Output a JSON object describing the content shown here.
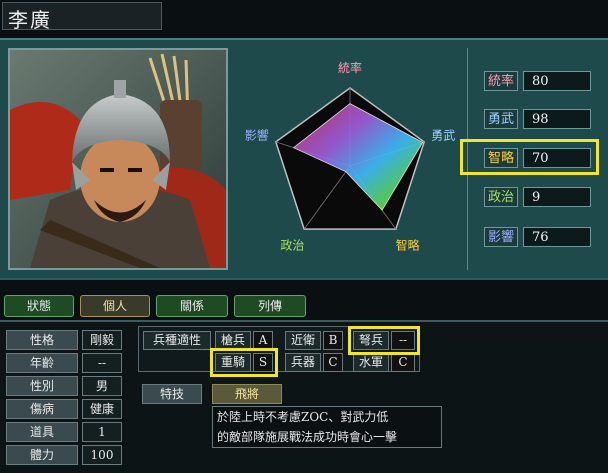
{
  "general": {
    "name": "李廣"
  },
  "radar": {
    "axes": [
      "統率",
      "勇武",
      "智略",
      "政治",
      "影響"
    ],
    "values": [
      80,
      98,
      70,
      9,
      76
    ],
    "max": 100,
    "axis_colors": [
      "#ff9ab0",
      "#9fd0ff",
      "#ffd040",
      "#a8e060",
      "#9ab0ff"
    ]
  },
  "stats": [
    {
      "label": "統率",
      "value": "80",
      "color": "#ff9ab0",
      "highlight": false
    },
    {
      "label": "勇武",
      "value": "98",
      "color": "#9fd0ff",
      "highlight": false
    },
    {
      "label": "智略",
      "value": "70",
      "color": "#ffd040",
      "highlight": true
    },
    {
      "label": "政治",
      "value": "9",
      "color": "#a8e060",
      "highlight": false
    },
    {
      "label": "影響",
      "value": "76",
      "color": "#9ab0ff",
      "highlight": false
    }
  ],
  "tabs": [
    {
      "label": "狀態",
      "active": false
    },
    {
      "label": "個人",
      "active": true
    },
    {
      "label": "關係",
      "active": false
    },
    {
      "label": "列傳",
      "active": false
    }
  ],
  "personal": [
    {
      "label": "性格",
      "value": "剛毅"
    },
    {
      "label": "年齡",
      "value": "--"
    },
    {
      "label": "性別",
      "value": "男"
    },
    {
      "label": "傷病",
      "value": "健康"
    },
    {
      "label": "道具",
      "value": "1"
    },
    {
      "label": "體力",
      "value": "100"
    }
  ],
  "suitability": {
    "header": "兵種適性",
    "units": [
      {
        "name": "槍兵",
        "grade": "A",
        "highlight": false
      },
      {
        "name": "近衛",
        "grade": "B",
        "highlight": false
      },
      {
        "name": "弩兵",
        "grade": "--",
        "highlight": true
      },
      {
        "name": "重騎",
        "grade": "S",
        "highlight": true
      },
      {
        "name": "兵器",
        "grade": "C",
        "highlight": false
      },
      {
        "name": "水軍",
        "grade": "C",
        "highlight": false
      }
    ]
  },
  "skill": {
    "label": "特技",
    "name": "飛將",
    "description_line1": "於陸上時不考慮ZOC、對武力低",
    "description_line2": "的敵部隊施展戰法成功時會心一擊"
  }
}
